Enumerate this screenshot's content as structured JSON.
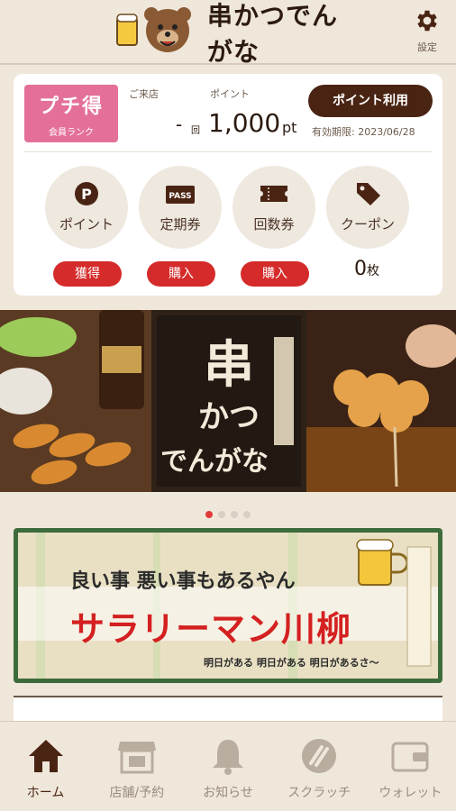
{
  "header": {
    "logo_text": "串かつでんがな",
    "settings_label": "設定"
  },
  "member": {
    "rank_title": "プチ得",
    "rank_sub": "会員ランク",
    "visits_label": "ご来店",
    "visits_value": "-",
    "visits_unit": "回",
    "points_label": "ポイント",
    "points_value": "1,000",
    "points_unit": "pt",
    "use_points_button": "ポイント利用",
    "expiry": "有効期限: 2023/06/28"
  },
  "features": [
    {
      "label": "ポイント",
      "icon": "p-coin-icon",
      "action": "獲得"
    },
    {
      "label": "定期券",
      "icon": "pass-icon",
      "action": "購入"
    },
    {
      "label": "回数券",
      "icon": "ticket-icon",
      "action": "購入"
    },
    {
      "label": "クーポン",
      "icon": "tag-icon"
    }
  ],
  "coupon_count": {
    "value": "0",
    "unit": "枚"
  },
  "carousel": {
    "slide_count": 4,
    "active_index": 0
  },
  "banner": {
    "line1": "良い事 悪い事もあるやん",
    "line2": "サラリーマン川柳",
    "line3": "明日がある 明日がある 明日があるさ〜"
  },
  "nav": [
    {
      "label": "ホーム",
      "icon": "home-icon",
      "active": true
    },
    {
      "label": "店舗/予約",
      "icon": "store-icon"
    },
    {
      "label": "お知らせ",
      "icon": "bell-icon"
    },
    {
      "label": "スクラッチ",
      "icon": "scratch-icon"
    },
    {
      "label": "ウォレット",
      "icon": "wallet-icon"
    }
  ],
  "colors": {
    "brown": "#4a2413",
    "red": "#d52b2b",
    "pink": "#e4709a",
    "bg": "#efe7da"
  }
}
